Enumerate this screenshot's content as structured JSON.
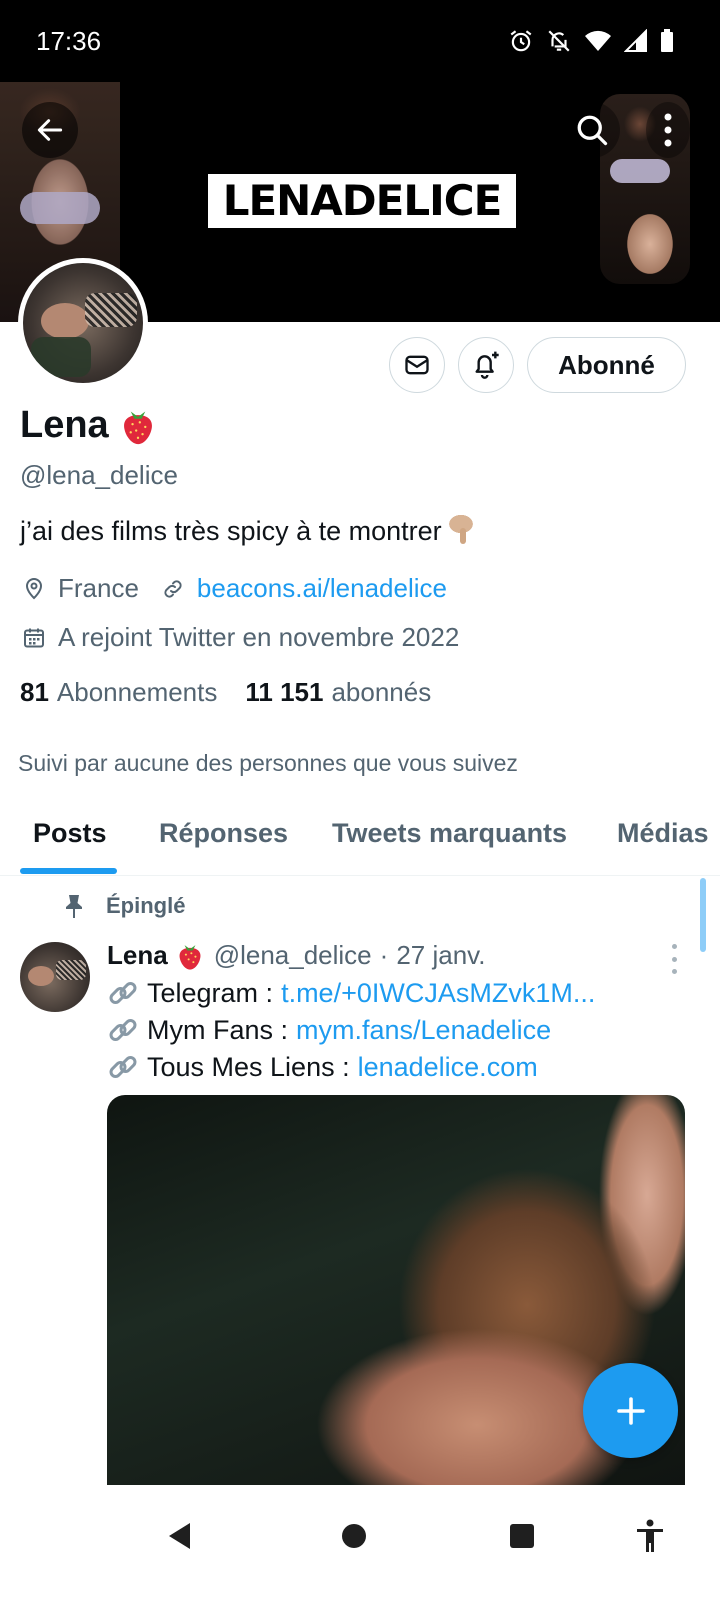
{
  "status_bar": {
    "time": "17:36",
    "icons": [
      "alarm-icon",
      "notifications-off-icon",
      "wifi-icon",
      "signal-icon",
      "battery-icon"
    ]
  },
  "banner": {
    "logo_text": "LENADELICE",
    "buttons": [
      "back-arrow-icon",
      "search-icon",
      "more-vertical-icon"
    ]
  },
  "profile": {
    "name": "Lena",
    "handle": "@lena_delice",
    "bio": "j’ai des films très spicy à te montrer",
    "location": "France",
    "website": "beacons.ai/lenadelice",
    "joined": "A rejoint Twitter en novembre 2022",
    "following_count": "81",
    "following_label": "Abonnements",
    "followers_count": "11 151",
    "followers_label": "abonnés",
    "followed_by": "Suivi par aucune des personnes que vous suivez"
  },
  "actions": {
    "follow_label": "Abonné",
    "icons": [
      "envelope-icon",
      "bell-plus-icon"
    ]
  },
  "tabs": [
    {
      "label": "Posts",
      "active": true
    },
    {
      "label": "Réponses",
      "active": false
    },
    {
      "label": "Tweets marquants",
      "active": false
    },
    {
      "label": "Médias",
      "active": false
    }
  ],
  "pinned_post": {
    "pinned_label": "Épinglé",
    "author": "Lena",
    "handle": "@lena_delice",
    "separator": "·",
    "date": "27 janv.",
    "lines": [
      {
        "label": "Telegram :",
        "link": "t.me/+0IWCJAsMZvk1M..."
      },
      {
        "label": "Mym Fans :",
        "link": "mym.fans/Lenadelice"
      },
      {
        "label": "Tous Mes Liens :",
        "link": "lenadelice.com"
      }
    ]
  },
  "colors": {
    "accent": "#1d9bf0",
    "text": "#0f1419",
    "muted": "#536471",
    "border": "#cfd9de"
  },
  "nav_bar": {
    "icons": [
      "back-triangle-icon",
      "home-circle-icon",
      "recents-square-icon",
      "accessibility-icon"
    ]
  }
}
